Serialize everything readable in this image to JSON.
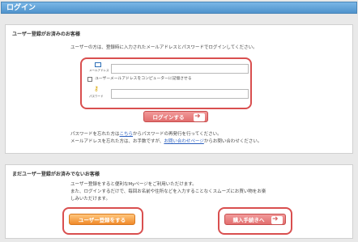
{
  "header": {
    "title": "ログイン"
  },
  "member": {
    "heading": "ユーザー登録がお済みのお客様",
    "intro": "ユーザーの方は、登録時に入力されたメールアドレスとパスワードでログインしてください。",
    "email_label": "メールアドレス",
    "email_value": "",
    "remember_label": "ユーザーメールアドレスをコンピューターに記憶させる",
    "password_label": "パスワード",
    "password_value": "",
    "login_button": "ログインする",
    "forgot_pw_prefix": "パスワードを忘れた方は",
    "forgot_pw_link": "こちら",
    "forgot_pw_suffix": "からパスワードの再発行を行ってください。",
    "forgot_email_prefix": "メールアドレスを忘れた方は、お手数ですが、",
    "forgot_email_link": "お問い合わせページ",
    "forgot_email_suffix": "からお問い合わせください。"
  },
  "guest": {
    "heading": "まだユーザー登録がお済みでないお客様",
    "line1": "ユーザー登録をすると便利なMyページをご利用いただけます。",
    "line2": "また、ログインするだけで、毎回お名前や住所などを入力することなくスムーズにお買い物をお楽",
    "line3": "しみいただけます。",
    "register_button": "ユーザー登録をする",
    "checkout_button": "購入手続きへ"
  }
}
